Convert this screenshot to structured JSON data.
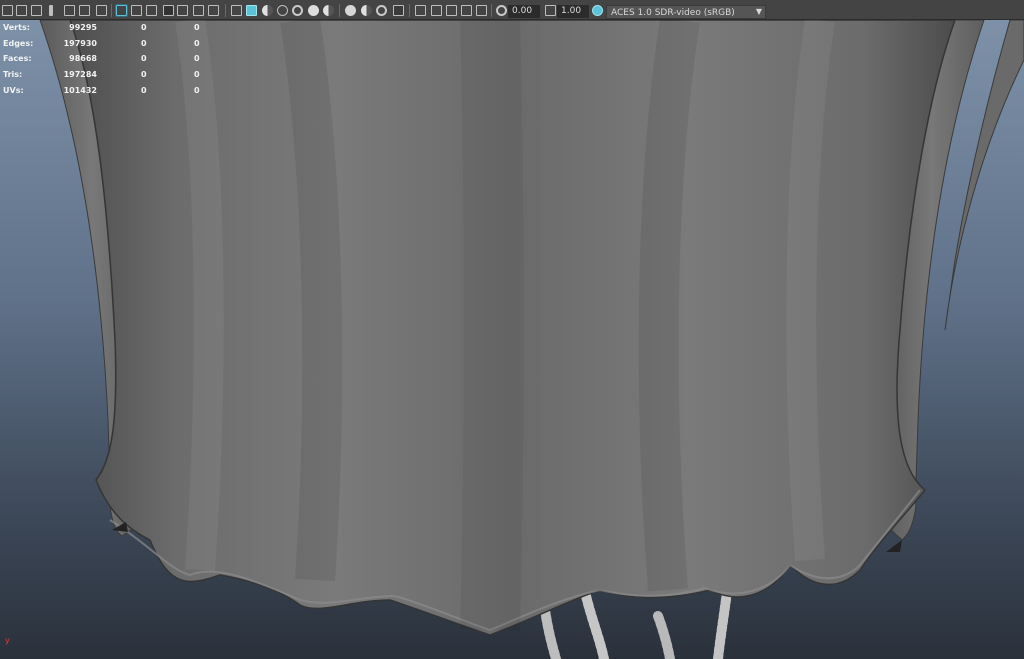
{
  "toolbar": {
    "exposure_value": "0.00",
    "gamma_value": "1.00",
    "colorspace": "ACES 1.0 SDR-video (sRGB)",
    "icons": [
      "camera-icon",
      "bookmark-icon",
      "grid-icon",
      "film-gate-icon",
      "resolution-gate-icon",
      "wireframe-icon",
      "smooth-shade-icon",
      "textured-icon",
      "light-icon",
      "shadow-icon",
      "ambient-occlusion-icon",
      "isolate-icon",
      "xray-icon",
      "exposure-icon",
      "gamma-icon",
      "color-management-icon"
    ]
  },
  "hud": {
    "rows": [
      {
        "label": "Verts:",
        "v1": "99295",
        "v2": "0",
        "v3": "0"
      },
      {
        "label": "Edges:",
        "v1": "197930",
        "v2": "0",
        "v3": "0"
      },
      {
        "label": "Faces:",
        "v1": "98668",
        "v2": "0",
        "v3": "0"
      },
      {
        "label": "Tris:",
        "v1": "197284",
        "v2": "0",
        "v3": "0"
      },
      {
        "label": "UVs:",
        "v1": "101432",
        "v2": "0",
        "v3": "0"
      }
    ]
  },
  "axis": {
    "y_label": "y"
  }
}
